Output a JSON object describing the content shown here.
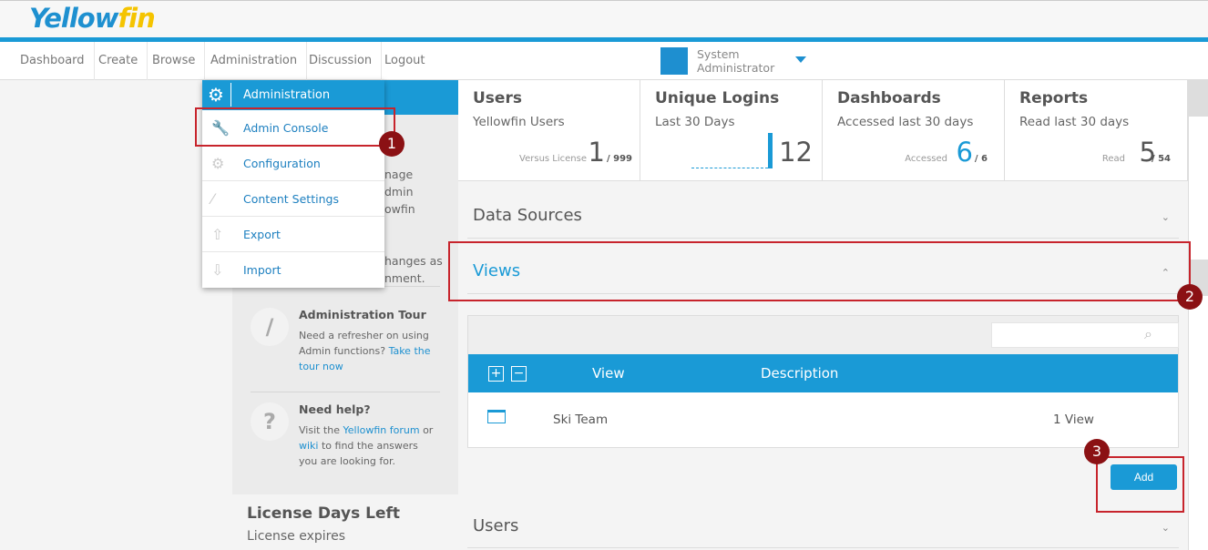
{
  "logo": {
    "text_a": "Yellow",
    "text_b": "fin"
  },
  "nav": {
    "items": [
      "Dashboard",
      "Create",
      "Browse",
      "Administration",
      "Discussion",
      "Logout"
    ]
  },
  "user": {
    "line1": "System",
    "line2": "Administrator"
  },
  "dropdown": {
    "title": "Administration",
    "items": [
      {
        "label": "Admin Console",
        "icon": "wrench-icon"
      },
      {
        "label": "Configuration",
        "icon": "gear-icon"
      },
      {
        "label": "Content Settings",
        "icon": "brush-icon"
      },
      {
        "label": "Export",
        "icon": "upload-icon"
      },
      {
        "label": "Import",
        "icon": "download-icon"
      }
    ]
  },
  "left_panel": {
    "fragments": [
      "nage",
      "dmin",
      "owfin",
      "hanges as",
      "nment."
    ],
    "tour": {
      "title": "Administration Tour",
      "text": "Need a refresher on using Admin functions? ",
      "link": "Take the tour now"
    },
    "help": {
      "title": "Need help?",
      "t1": "Visit the ",
      "link1": "Yellowfin forum",
      "t2": " or ",
      "link2": "wiki",
      "t3": " to find the answers you are looking for."
    },
    "license": {
      "title": "License Days Left",
      "sub": "License expires"
    }
  },
  "cards": [
    {
      "title": "Users",
      "sub": "Yellowfin Users",
      "label": "Versus License",
      "value": "1",
      "of": "/ 999"
    },
    {
      "title": "Unique Logins",
      "sub": "Last 30 Days",
      "value": "12"
    },
    {
      "title": "Dashboards",
      "sub": "Accessed last 30 days",
      "label": "Accessed",
      "value": "6",
      "of": "/ 6"
    },
    {
      "title": "Reports",
      "sub": "Read last 30 days",
      "label": "Read",
      "value": "5",
      "of": "/ 54"
    }
  ],
  "sections": {
    "data_sources": "Data Sources",
    "views": "Views",
    "users": "Users"
  },
  "views_table": {
    "columns": [
      "View",
      "Description"
    ],
    "rows": [
      {
        "name": "Ski Team",
        "count": "1 View"
      }
    ],
    "search_placeholder": ""
  },
  "add_button": "Add",
  "badges": [
    "1",
    "2",
    "3"
  ],
  "colors": {
    "accent": "#1a9ad6",
    "annotation": "#c7242c",
    "badge": "#8b1114"
  }
}
